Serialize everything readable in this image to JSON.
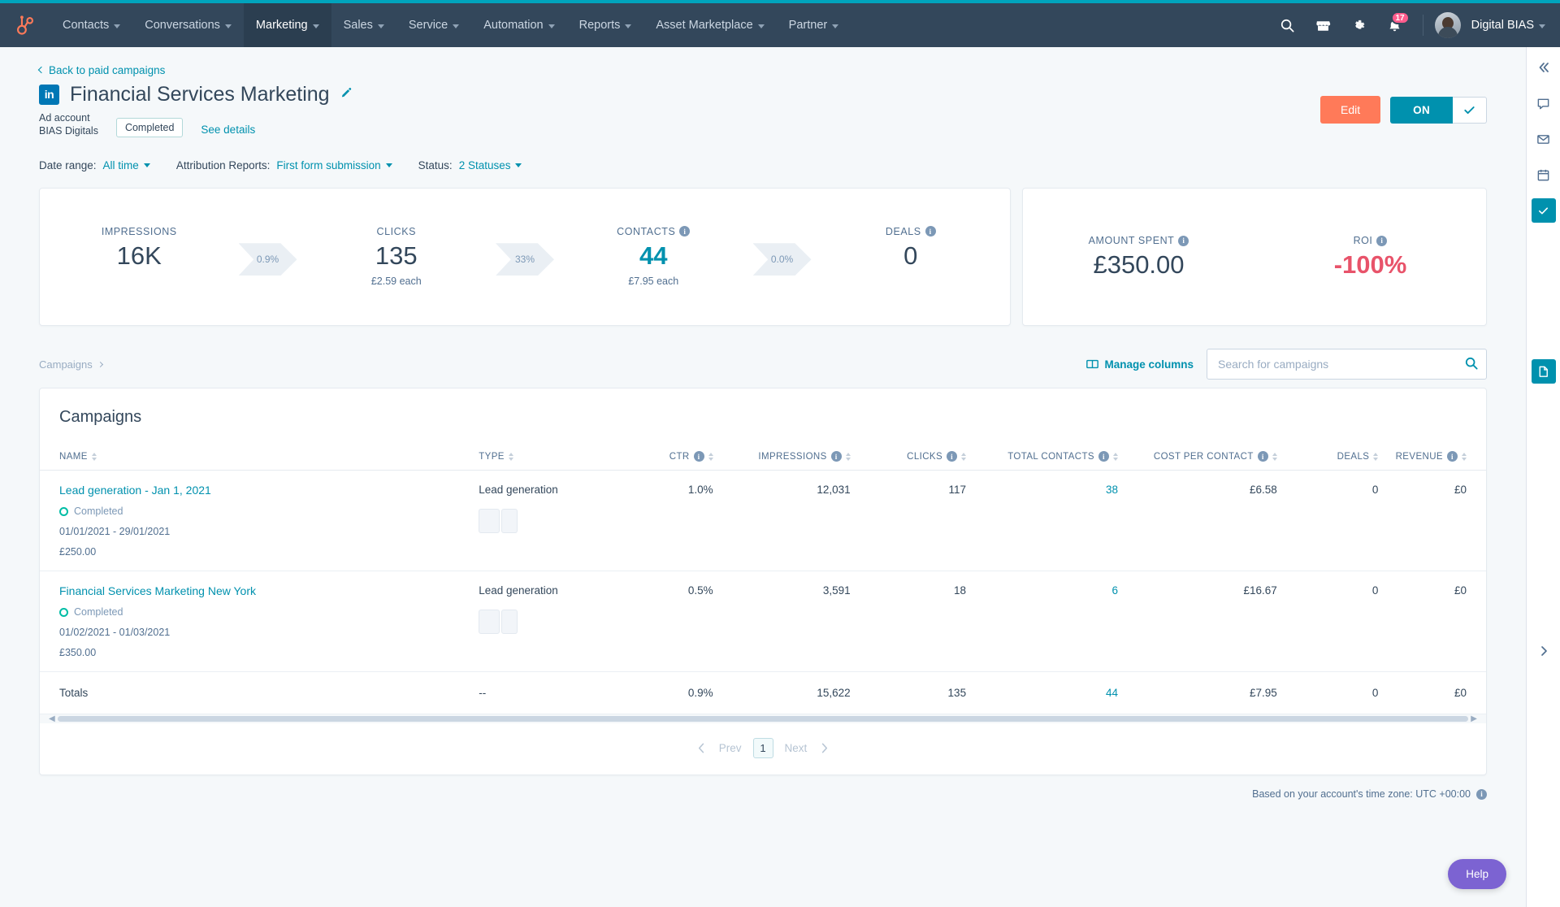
{
  "topnav": {
    "logo_icon": "hubspot-sprocket-icon",
    "items": [
      {
        "label": "Contacts",
        "active": false
      },
      {
        "label": "Conversations",
        "active": false
      },
      {
        "label": "Marketing",
        "active": true
      },
      {
        "label": "Sales",
        "active": false
      },
      {
        "label": "Service",
        "active": false
      },
      {
        "label": "Automation",
        "active": false
      },
      {
        "label": "Reports",
        "active": false
      },
      {
        "label": "Asset Marketplace",
        "active": false
      },
      {
        "label": "Partner",
        "active": false
      }
    ],
    "icons": [
      "search-icon",
      "marketplace-icon",
      "settings-gear-icon",
      "notifications-bell-icon"
    ],
    "notification_count": "17",
    "account_name": "Digital BIAS"
  },
  "header": {
    "back_link": "Back to paid campaigns",
    "network_icon": "linkedin-icon",
    "network_label": "in",
    "title": "Financial Services Marketing",
    "edit_title_icon": "pencil-icon",
    "ad_account_label": "Ad account",
    "ad_account_name": "BIAS Digitals",
    "status_pill": "Completed",
    "see_details": "See details",
    "edit_button": "Edit",
    "toggle_on": "ON",
    "toggle_check_icon": "check-icon"
  },
  "filters": {
    "date_range_label": "Date range:",
    "date_range_value": "All time",
    "attribution_label": "Attribution Reports:",
    "attribution_value": "First form submission",
    "status_label": "Status:",
    "status_value": "2 Statuses"
  },
  "funnel": {
    "metrics": [
      {
        "label": "IMPRESSIONS",
        "value": "16K",
        "sub": "",
        "info": false,
        "style": "plain"
      },
      {
        "label": "CLICKS",
        "value": "135",
        "sub": "£2.59 each",
        "info": false,
        "style": "plain"
      },
      {
        "label": "CONTACTS",
        "value": "44",
        "sub": "£7.95 each",
        "info": true,
        "style": "teal"
      },
      {
        "label": "DEALS",
        "value": "0",
        "sub": "",
        "info": true,
        "style": "plain"
      }
    ],
    "conversions": [
      "0.9%",
      "33%",
      "0.0%"
    ]
  },
  "spend": {
    "metrics": [
      {
        "label": "AMOUNT SPENT",
        "value": "£350.00",
        "info": true,
        "style": "plain"
      },
      {
        "label": "ROI",
        "value": "-100%",
        "info": true,
        "style": "red"
      }
    ]
  },
  "toolbar": {
    "breadcrumb": "Campaigns",
    "manage_columns": "Manage columns",
    "manage_columns_icon": "columns-icon",
    "search_placeholder": "Search for campaigns",
    "search_value": "",
    "search_icon": "search-icon"
  },
  "table": {
    "title": "Campaigns",
    "columns": [
      {
        "label": "NAME",
        "align": "left",
        "info": false
      },
      {
        "label": "TYPE",
        "align": "left",
        "info": false
      },
      {
        "label": "CTR",
        "align": "right",
        "info": true
      },
      {
        "label": "IMPRESSIONS",
        "align": "right",
        "info": true
      },
      {
        "label": "CLICKS",
        "align": "right",
        "info": true
      },
      {
        "label": "TOTAL CONTACTS",
        "align": "right",
        "info": true
      },
      {
        "label": "COST PER CONTACT",
        "align": "right",
        "info": true
      },
      {
        "label": "DEALS",
        "align": "right",
        "info": false
      },
      {
        "label": "REVENUE",
        "align": "right",
        "info": true
      }
    ],
    "rows": [
      {
        "name": "Lead generation - Jan 1, 2021",
        "status": "Completed",
        "dates": "01/01/2021 - 29/01/2021",
        "budget": "£250.00",
        "type": "Lead generation",
        "ctr": "1.0%",
        "impressions": "12,031",
        "clicks": "117",
        "total_contacts": "38",
        "cost_per_contact": "£6.58",
        "deals": "0",
        "revenue": "£0"
      },
      {
        "name": "Financial Services Marketing New York",
        "status": "Completed",
        "dates": "01/02/2021 - 01/03/2021",
        "budget": "£350.00",
        "type": "Lead generation",
        "ctr": "0.5%",
        "impressions": "3,591",
        "clicks": "18",
        "total_contacts": "6",
        "cost_per_contact": "£16.67",
        "deals": "0",
        "revenue": "£0"
      }
    ],
    "totals": {
      "name": "Totals",
      "type": "--",
      "ctr": "0.9%",
      "impressions": "15,622",
      "clicks": "135",
      "total_contacts": "44",
      "cost_per_contact": "£7.95",
      "deals": "0",
      "revenue": "£0"
    }
  },
  "pagination": {
    "prev": "Prev",
    "current": "1",
    "next": "Next"
  },
  "footer": {
    "timezone_note": "Based on your account's time zone: UTC +00:00",
    "help_label": "Help"
  },
  "colors": {
    "nav_bg": "#33475b",
    "accent_teal": "#0091ae",
    "brand_orange": "#ff7a59",
    "status_green": "#00bda5",
    "roi_red": "#e8536a",
    "page_bg": "#f5f8fa"
  }
}
